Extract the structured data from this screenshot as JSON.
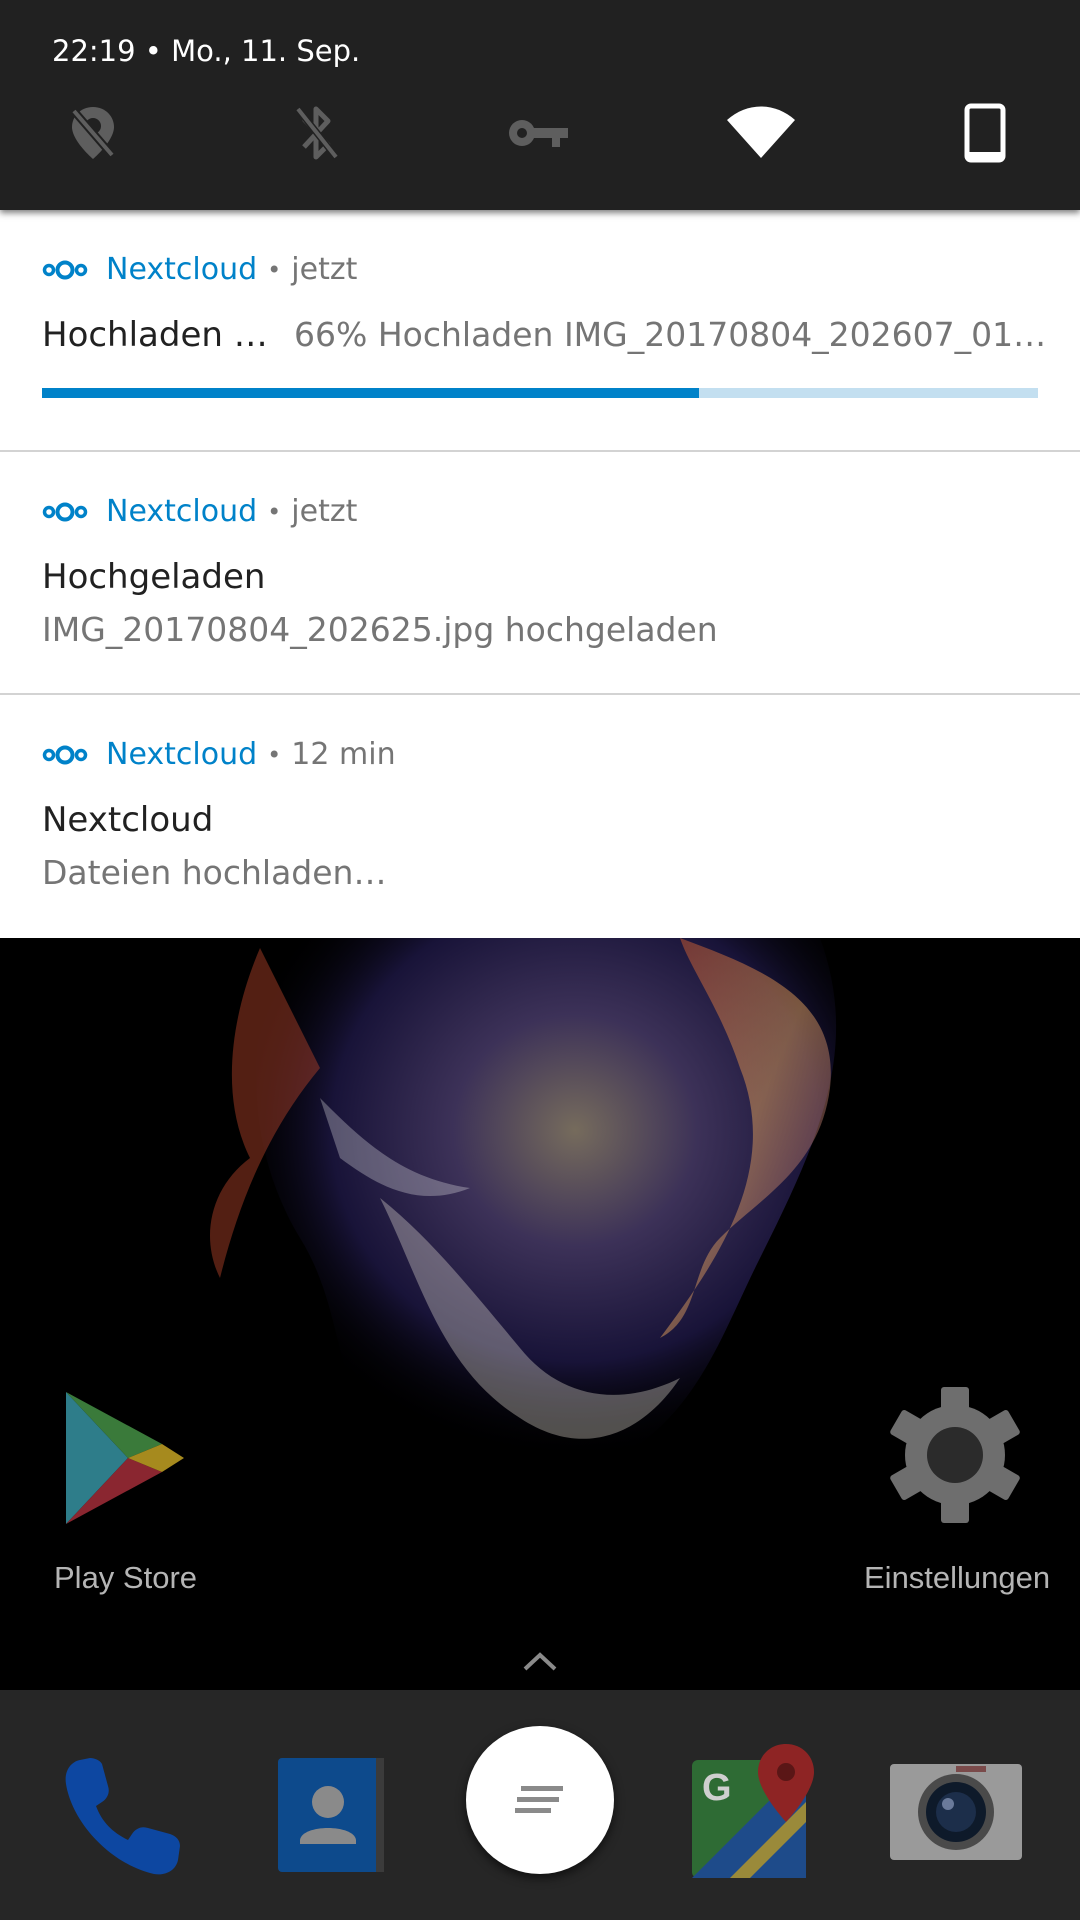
{
  "status": {
    "datetime": "22:19 • Mo., 11. Sep."
  },
  "quick_tiles": [
    {
      "icon": "location-off-icon"
    },
    {
      "icon": "bluetooth-off-icon"
    },
    {
      "icon": "vpn-key-icon"
    },
    {
      "icon": "wifi-icon"
    },
    {
      "icon": "phone-portrait-icon"
    }
  ],
  "notifications": [
    {
      "app": "Nextcloud",
      "time": "jetzt",
      "title": "Hochladen …",
      "text": "66% Hochladen IMG_20170804_202607_01…",
      "progress": 0.66
    },
    {
      "app": "Nextcloud",
      "time": "jetzt",
      "title": "Hochgeladen",
      "text": "IMG_20170804_202625.jpg hochgeladen"
    },
    {
      "app": "Nextcloud",
      "time": "12 min",
      "title": "Nextcloud",
      "text": "Dateien hochladen…"
    }
  ],
  "home": {
    "apps": [
      {
        "label": "Play Store",
        "icon": "play-store-icon"
      },
      {
        "label": "Einstellungen",
        "icon": "settings-gear-icon"
      }
    ],
    "dock": [
      {
        "icon": "phone-icon"
      },
      {
        "icon": "contacts-icon"
      },
      {
        "icon": "app-drawer-icon"
      },
      {
        "icon": "maps-icon"
      },
      {
        "icon": "camera-icon"
      }
    ]
  },
  "colors": {
    "accent": "#0082c9",
    "header_bg": "#212121",
    "dock_bg": "#262626"
  }
}
